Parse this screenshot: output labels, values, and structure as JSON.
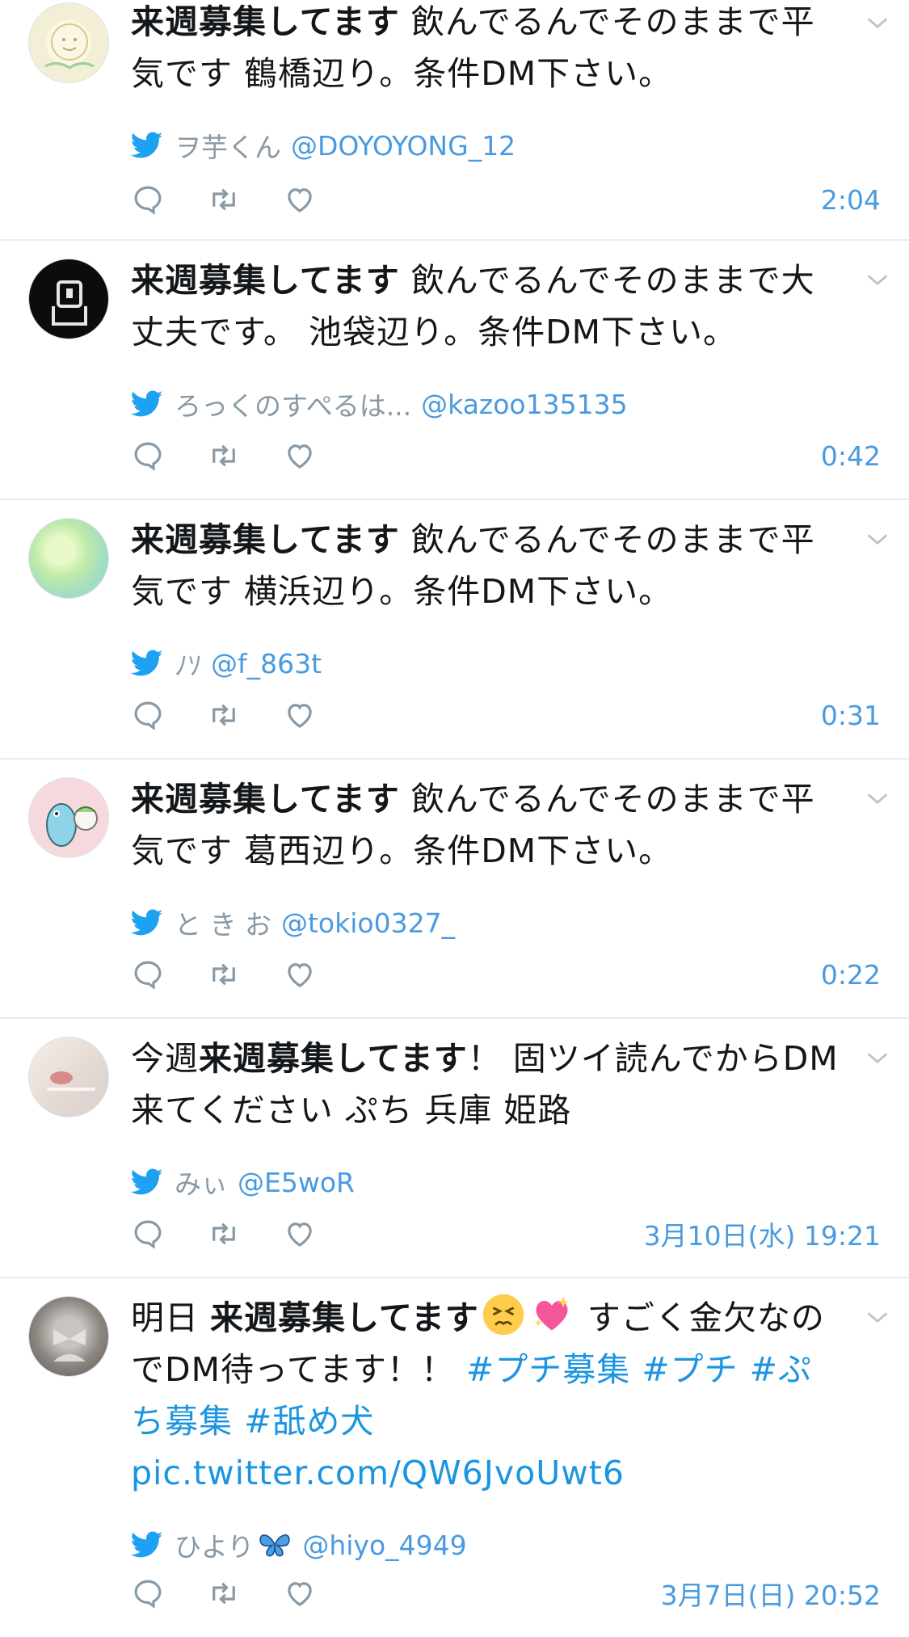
{
  "tweets": [
    {
      "pre": "",
      "bold": "来週募集してます",
      "post": " 飲んでるんでそのままで平気です 鶴橋辺り。条件DM下さい。",
      "name": "ヲ芋くん",
      "handle": "@DOYOYONG_12",
      "time": "2:04"
    },
    {
      "pre": "",
      "bold": "来週募集してます",
      "post": " 飲んでるんでそのままで大丈夫です。 池袋辺り。条件DM下さい。",
      "name": "ろっくのすぺるは...",
      "handle": "@kazoo135135",
      "time": "0:42"
    },
    {
      "pre": "",
      "bold": "来週募集してます",
      "post": " 飲んでるんでそのままで平気です 横浜辺り。条件DM下さい。",
      "name": "ﾉｿ",
      "handle": "@f_863t",
      "time": "0:31"
    },
    {
      "pre": "",
      "bold": "来週募集してます",
      "post": " 飲んでるんでそのままで平気です 葛西辺り。条件DM下さい。",
      "name": "と き お",
      "handle": "@tokio0327_",
      "time": "0:22"
    },
    {
      "pre": "今週",
      "bold": "来週募集してます",
      "post": "！ 固ツイ読んでからDM来てください ぷち 兵庫 姫路",
      "name": "みぃ",
      "handle": "@E5woR",
      "time": "3月10日(水) 19:21"
    },
    {
      "pre": "明日 ",
      "bold": "来週募集してます",
      "post": " すごく金欠なのでDM待ってます！！ ",
      "hashtags": "#プチ募集 #プチ #ぷち募集 #舐め犬",
      "link": "pic.twitter.com/QW6JvoUwt6",
      "name": "ひより",
      "handle": "@hiyo_4949",
      "time": "3月7日(日) 20:52"
    }
  ],
  "icons": [
    "chevron-down-icon",
    "twitter-bird-icon",
    "reply-icon",
    "retweet-icon",
    "like-icon"
  ],
  "colors": {
    "accent": "#1b95e0",
    "link": "#4a9ae0",
    "muted": "#8899a6",
    "divider": "#e6ecf0"
  }
}
